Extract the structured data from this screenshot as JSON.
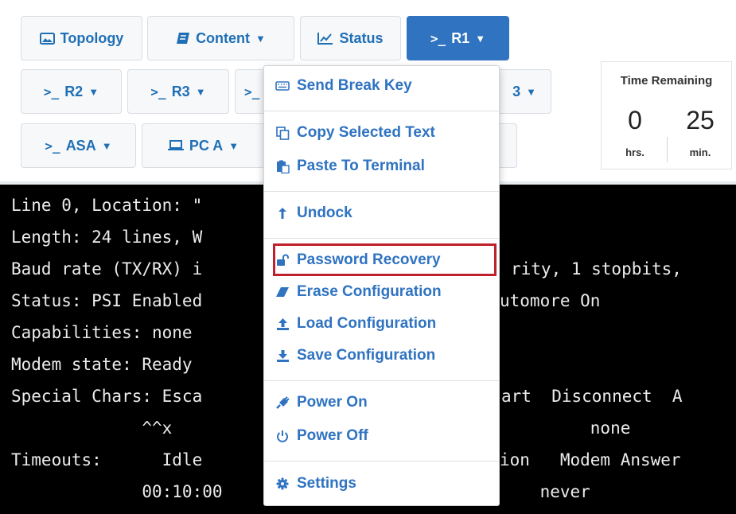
{
  "toolbar": {
    "topology": "Topology",
    "content": "Content",
    "status": "Status",
    "r1": "R1",
    "r2": "R2",
    "r3": "R3",
    "r4_partial": ">_",
    "row2_partial_label": "3",
    "asa": "ASA",
    "pca": "PC A",
    "terminal_prefix": ">_"
  },
  "timer": {
    "title": "Time Remaining",
    "hours": "0",
    "minutes": "25",
    "hours_unit": "hrs.",
    "minutes_unit": "min."
  },
  "menu": {
    "send_break_key": "Send Break Key",
    "copy_selected_text": "Copy Selected Text",
    "paste_to_terminal": "Paste To Terminal",
    "undock": "Undock",
    "password_recovery": "Password Recovery",
    "erase_configuration": "Erase Configuration",
    "load_configuration": "Load Configuration",
    "save_configuration": "Save Configuration",
    "power_on": "Power On",
    "power_off": "Power Off",
    "settings": "Settings"
  },
  "terminal": {
    "lines": [
      {
        "left": "Line 0, Location: \"",
        "right": ""
      },
      {
        "left": "Length: 24 lines, W",
        "right": ""
      },
      {
        "left": "Baud rate (TX/RX) i",
        "right": "rity, 1 stopbits,"
      },
      {
        "left": "Status: PSI Enabled",
        "right": "utomore On"
      },
      {
        "left": "Capabilities: none",
        "right": ""
      },
      {
        "left": "Modem state: Ready",
        "right": ""
      },
      {
        "left": "Special Chars: Esca",
        "right": "art  Disconnect  A"
      },
      {
        "left": "             ^^x",
        "right": "         none"
      },
      {
        "left": "Timeouts:      Idle",
        "right": "ion   Modem Answer"
      },
      {
        "left": "             00:10:00",
        "right": "    never"
      }
    ]
  },
  "colors": {
    "accent": "#2f73c1",
    "highlight_border": "#c0202a",
    "terminal_bg": "#000000"
  }
}
